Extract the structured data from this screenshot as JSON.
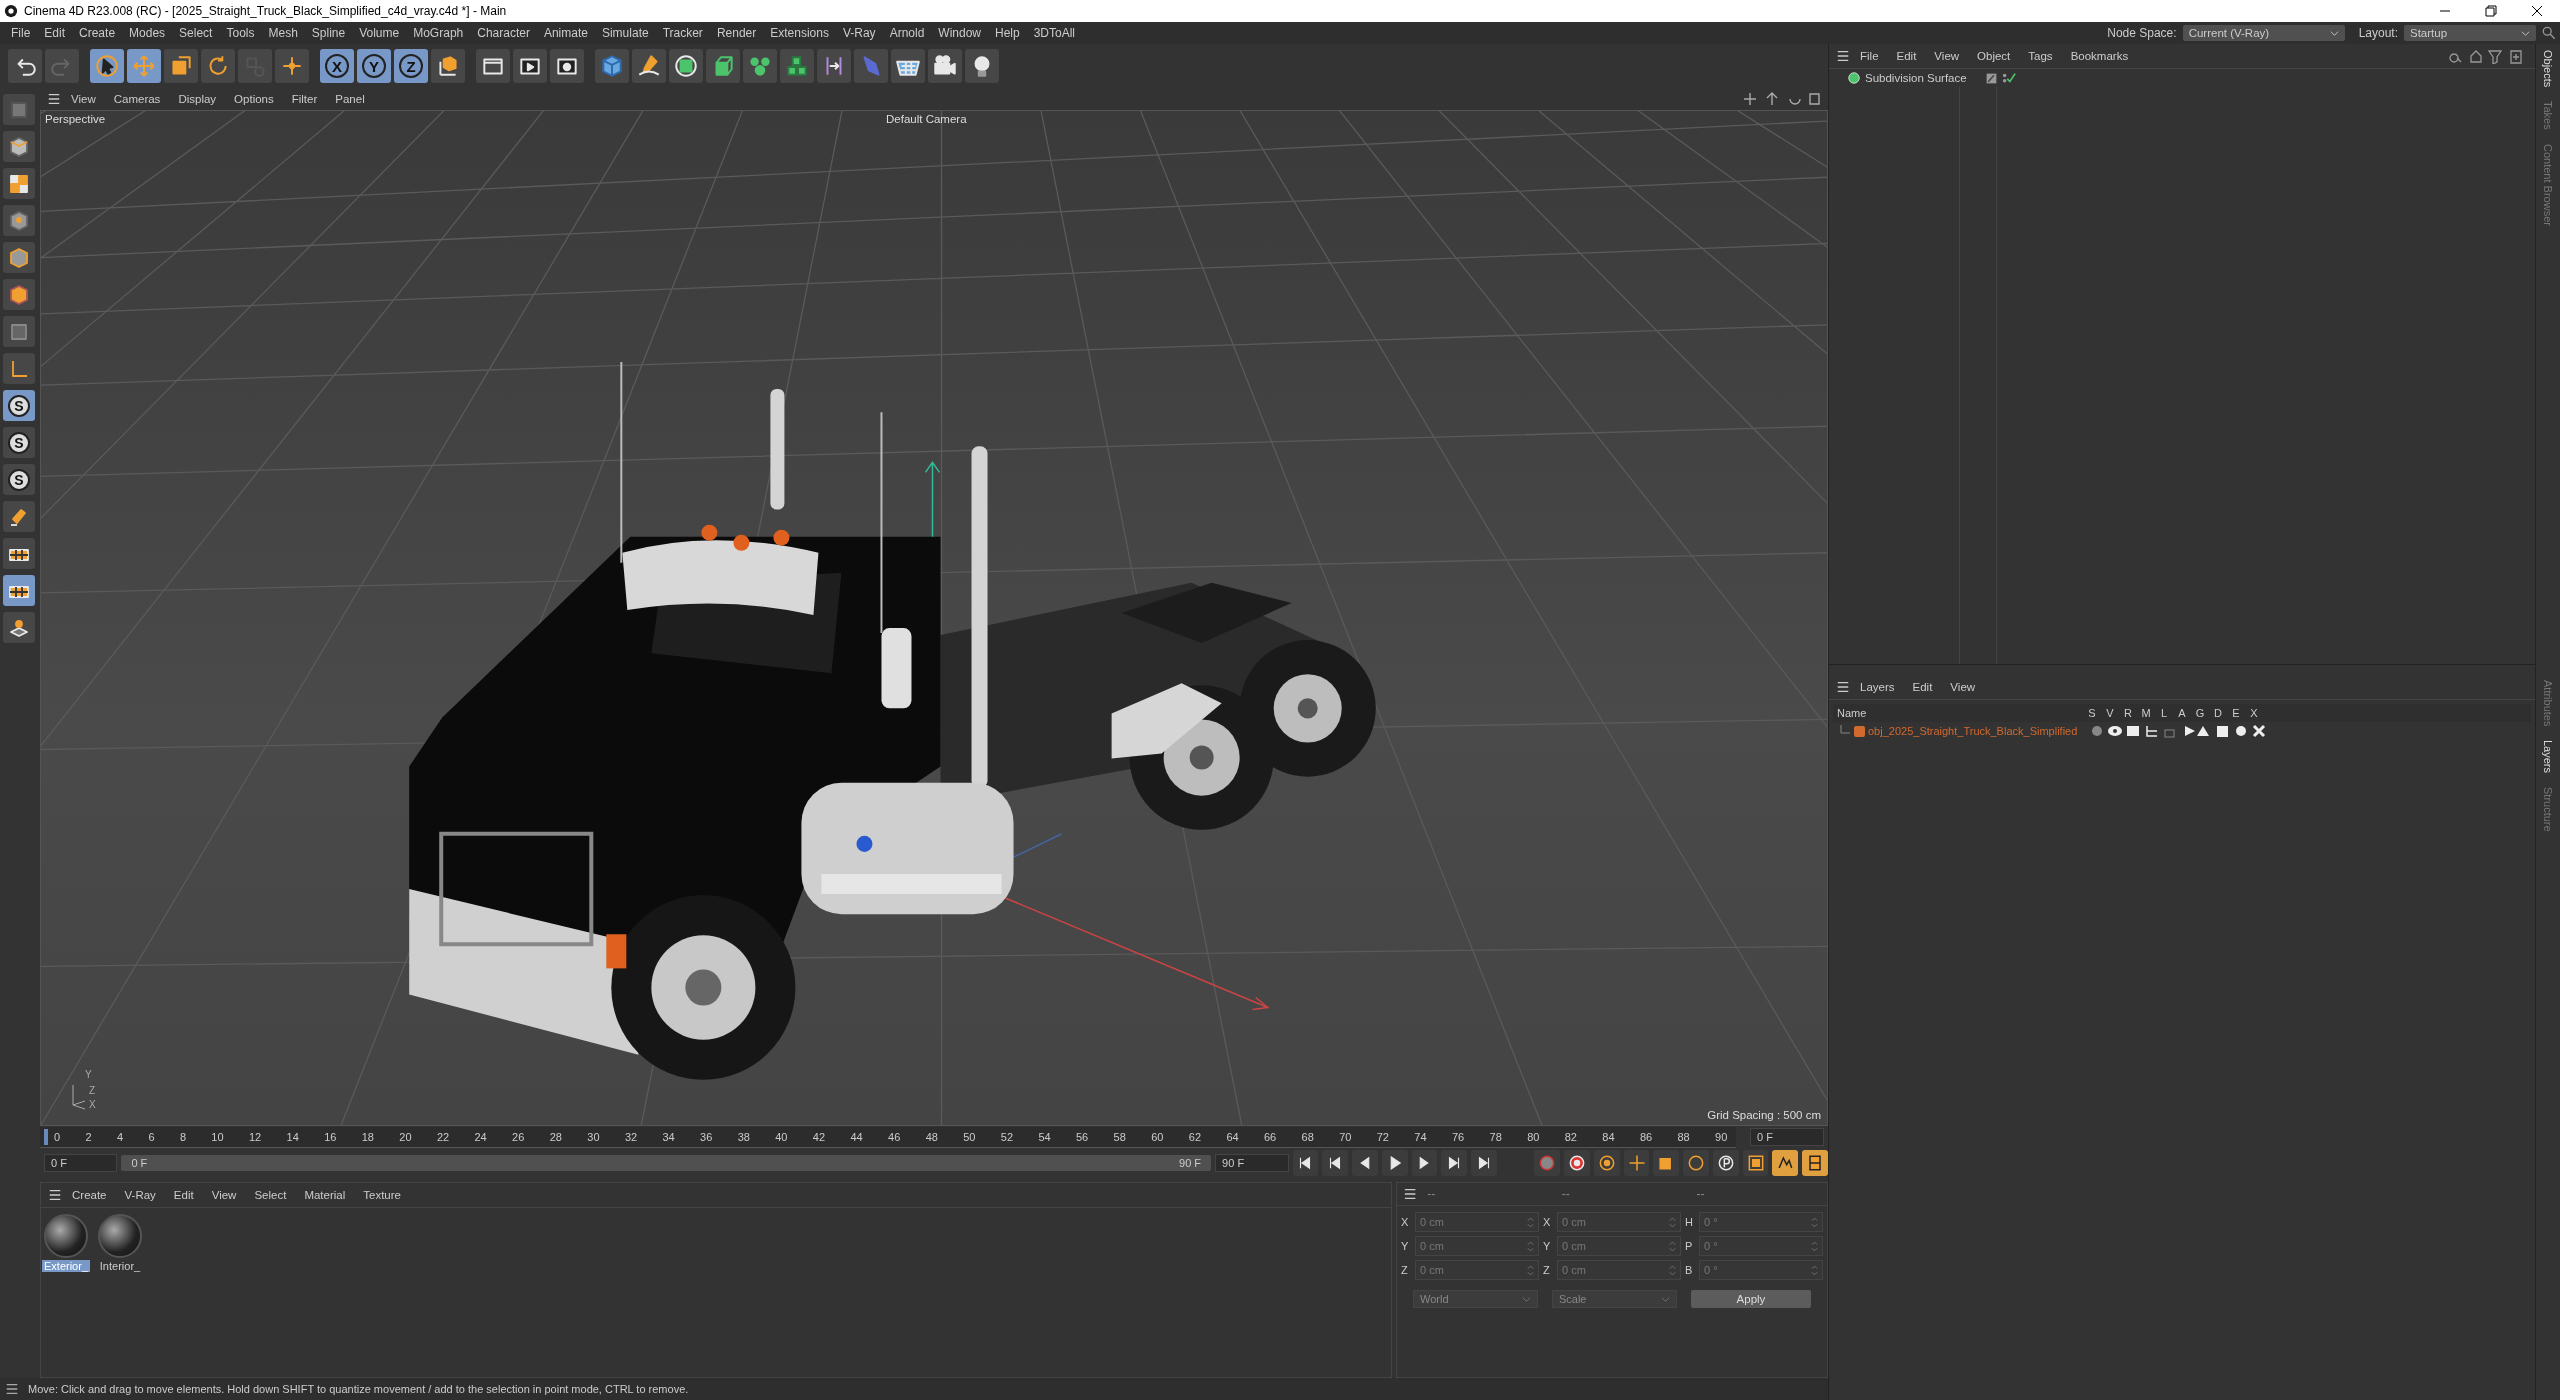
{
  "window": {
    "title": "Cinema 4D R23.008 (RC) - [2025_Straight_Truck_Black_Simplified_c4d_vray.c4d *] - Main"
  },
  "menu": [
    "File",
    "Edit",
    "Create",
    "Modes",
    "Select",
    "Tools",
    "Mesh",
    "Spline",
    "Volume",
    "MoGraph",
    "Character",
    "Animate",
    "Simulate",
    "Tracker",
    "Render",
    "Extensions",
    "V-Ray",
    "Arnold",
    "Window",
    "Help",
    "3DToAll"
  ],
  "node_space": {
    "label": "Node Space:",
    "value": "Current (V-Ray)"
  },
  "layout": {
    "label": "Layout:",
    "value": "Startup"
  },
  "toolbar": [
    {
      "kind": "undo",
      "selected": false
    },
    {
      "kind": "redo",
      "selected": false
    },
    {
      "kind": "select",
      "selected": true
    },
    {
      "kind": "move",
      "selected": true
    },
    {
      "kind": "scale",
      "selected": false
    },
    {
      "kind": "rotate",
      "selected": false
    },
    {
      "kind": "pbr",
      "selected": false
    },
    {
      "kind": "transform",
      "selected": false
    },
    {
      "kind": "axis",
      "label": "X",
      "selected": true
    },
    {
      "kind": "axis",
      "label": "Y",
      "selected": true
    },
    {
      "kind": "axis",
      "label": "Z",
      "selected": true
    },
    {
      "kind": "coord",
      "selected": false
    },
    {
      "kind": "render_region",
      "selected": false
    },
    {
      "kind": "render_view",
      "selected": false
    },
    {
      "kind": "render_settings",
      "selected": false
    },
    {
      "kind": "cube",
      "selected": false
    },
    {
      "kind": "pen",
      "selected": false
    },
    {
      "kind": "subdiv",
      "selected": false
    },
    {
      "kind": "extrude",
      "selected": false
    },
    {
      "kind": "cloner",
      "selected": false
    },
    {
      "kind": "array",
      "selected": false
    },
    {
      "kind": "deformer",
      "selected": false
    },
    {
      "kind": "spline",
      "selected": false
    },
    {
      "kind": "floor",
      "selected": false
    },
    {
      "kind": "camera",
      "selected": false
    },
    {
      "kind": "light",
      "selected": false
    }
  ],
  "left_tools": [
    {
      "kind": "model",
      "selected": false
    },
    {
      "kind": "object",
      "selected": false
    },
    {
      "kind": "texture",
      "selected": false
    },
    {
      "kind": "points",
      "selected": false
    },
    {
      "kind": "edges",
      "selected": false
    },
    {
      "kind": "polygons",
      "selected": false
    },
    {
      "kind": "uv",
      "selected": false
    },
    {
      "kind": "axis",
      "selected": false
    },
    {
      "kind": "snap",
      "label": "S",
      "selected": true
    },
    {
      "kind": "snap",
      "label": "S",
      "selected": false
    },
    {
      "kind": "snap",
      "label": "S",
      "selected": false
    },
    {
      "kind": "tweak",
      "selected": false
    },
    {
      "kind": "grid",
      "selected": false
    },
    {
      "kind": "grid",
      "selected": true
    },
    {
      "kind": "workplane",
      "selected": false
    }
  ],
  "viewport": {
    "menu": [
      "View",
      "Cameras",
      "Display",
      "Options",
      "Filter",
      "Panel"
    ],
    "view_name": "Perspective",
    "camera": "Default Camera",
    "grid_spacing": "Grid Spacing : 500 cm",
    "gizmo_labels": [
      "Y",
      "Z",
      "X"
    ]
  },
  "timeline": {
    "ticks": [
      "0",
      "2",
      "4",
      "6",
      "8",
      "10",
      "12",
      "14",
      "16",
      "18",
      "20",
      "22",
      "24",
      "26",
      "28",
      "30",
      "32",
      "34",
      "36",
      "38",
      "40",
      "42",
      "44",
      "46",
      "48",
      "50",
      "52",
      "54",
      "56",
      "58",
      "60",
      "62",
      "64",
      "66",
      "68",
      "70",
      "72",
      "74",
      "76",
      "78",
      "80",
      "82",
      "84",
      "86",
      "88",
      "90"
    ],
    "level": 0,
    "current_frame": "0 F",
    "start_field": "0 F",
    "range_start": "0 F",
    "range_end": "90 F",
    "end_field": "90 F"
  },
  "transport": [
    {
      "kind": "first"
    },
    {
      "kind": "prev_key"
    },
    {
      "kind": "prev_frame"
    },
    {
      "kind": "play"
    },
    {
      "kind": "next_frame"
    },
    {
      "kind": "next_key"
    },
    {
      "kind": "last"
    }
  ],
  "key_tools": [
    {
      "kind": "autokey"
    },
    {
      "kind": "record"
    },
    {
      "kind": "key_position"
    },
    {
      "kind": "key_move"
    },
    {
      "kind": "key_scale"
    },
    {
      "kind": "key_rotate"
    },
    {
      "kind": "key_param"
    },
    {
      "kind": "key_pla"
    },
    {
      "kind": "dope"
    },
    {
      "kind": "timeline_layout"
    }
  ],
  "materials": {
    "menu": [
      "Create",
      "V-Ray",
      "Edit",
      "View",
      "Select",
      "Material",
      "Texture"
    ],
    "items": [
      {
        "name": "Exterior_",
        "selected": true
      },
      {
        "name": "Interior_",
        "selected": false
      }
    ]
  },
  "coordinates": {
    "columns": [
      {
        "header": "--",
        "fields": [
          {
            "label": "X",
            "value": "0 cm"
          },
          {
            "label": "Y",
            "value": "0 cm"
          },
          {
            "label": "Z",
            "value": "0 cm"
          }
        ]
      },
      {
        "header": "--",
        "fields": [
          {
            "label": "X",
            "value": "0 cm"
          },
          {
            "label": "Y",
            "value": "0 cm"
          },
          {
            "label": "Z",
            "value": "0 cm"
          }
        ]
      },
      {
        "header": "--",
        "fields": [
          {
            "label": "H",
            "value": "0 °"
          },
          {
            "label": "P",
            "value": "0 °"
          },
          {
            "label": "B",
            "value": "0 °"
          }
        ]
      }
    ],
    "dropdowns": [
      "World",
      "Scale"
    ],
    "apply": "Apply"
  },
  "objects": {
    "menu": [
      "File",
      "Edit",
      "View",
      "Object",
      "Tags",
      "Bookmarks"
    ],
    "items": [
      {
        "name": "Subdivision Surface"
      }
    ]
  },
  "layers": {
    "menu": [
      "Layers",
      "Edit",
      "View"
    ],
    "columns": [
      "Name",
      "S",
      "V",
      "R",
      "M",
      "L",
      "A",
      "G",
      "D",
      "E",
      "X"
    ],
    "rows": [
      {
        "name": "obj_2025_Straight_Truck_Black_Simplified",
        "color": "#d2692f"
      }
    ]
  },
  "side_tabs": [
    {
      "label": "Objects",
      "selected": true
    },
    {
      "label": "Takes",
      "selected": false
    },
    {
      "label": "Content Browser",
      "selected": false
    },
    {
      "label": "Attributes",
      "selected": false
    },
    {
      "label": "Layers",
      "selected": true
    },
    {
      "label": "Structure",
      "selected": false
    }
  ],
  "status_bar": "Move: Click and drag to move elements. Hold down SHIFT to quantize movement / add to the selection in point mode, CTRL to remove."
}
